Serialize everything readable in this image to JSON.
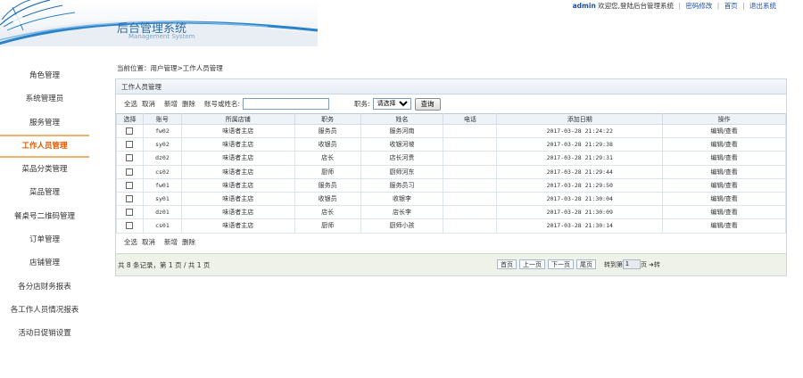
{
  "header": {
    "system_title": "后台管理系统",
    "system_subtitle": "Management System",
    "user": "admin",
    "welcome": "欢迎您,登陆后台管理系统",
    "links": [
      "密码修改",
      "首页",
      "退出系统"
    ],
    "separator": "|"
  },
  "sidebar": {
    "items": [
      {
        "label": "角色管理",
        "active": false
      },
      {
        "label": "系统管理员",
        "active": false
      },
      {
        "label": "服务管理",
        "active": false
      },
      {
        "label": "工作人员管理",
        "active": true
      },
      {
        "label": "菜品分类管理",
        "active": false
      },
      {
        "label": "菜品管理",
        "active": false
      },
      {
        "label": "餐桌号二维码管理",
        "active": false
      },
      {
        "label": "订单管理",
        "active": false
      },
      {
        "label": "店铺管理",
        "active": false
      },
      {
        "label": "各分店财务报表",
        "active": false
      },
      {
        "label": "各工作人员情况报表",
        "active": false
      },
      {
        "label": "活动日促销设置",
        "active": false
      }
    ]
  },
  "breadcrumb": "当前位置：用户管理>工作人员管理",
  "panel": {
    "title": "工作人员管理",
    "toolbar": {
      "select_all": "全选",
      "cancel": "取消",
      "add": "新增",
      "delete": "删除",
      "name_label": "账号或姓名:",
      "name_value": "",
      "role_label": "职务:",
      "role_selected": "请选择",
      "search_button": "查询"
    },
    "table": {
      "columns": [
        "选择",
        "账号",
        "所属店铺",
        "职务",
        "姓名",
        "电话",
        "添加日期",
        "操作"
      ],
      "rows": [
        {
          "account": "fw02",
          "shop": "味语者主店",
          "role": "服务员",
          "name": "服务河南",
          "phone": "",
          "date": "2017-03-28 21:24:22",
          "op": "编辑/查看"
        },
        {
          "account": "sy02",
          "shop": "味语者主店",
          "role": "收银员",
          "name": "收银河坡",
          "phone": "",
          "date": "2017-03-28 21:29:38",
          "op": "编辑/查看"
        },
        {
          "account": "dz02",
          "shop": "味语者主店",
          "role": "店长",
          "name": "店长河贵",
          "phone": "",
          "date": "2017-03-28 21:29:31",
          "op": "编辑/查看"
        },
        {
          "account": "cs02",
          "shop": "味语者主店",
          "role": "厨师",
          "name": "厨师河东",
          "phone": "",
          "date": "2017-03-28 21:29:44",
          "op": "编辑/查看"
        },
        {
          "account": "fw01",
          "shop": "味语者主店",
          "role": "服务员",
          "name": "服务员习",
          "phone": "",
          "date": "2017-03-28 21:29:50",
          "op": "编辑/查看"
        },
        {
          "account": "sy01",
          "shop": "味语者主店",
          "role": "收银员",
          "name": "收银李",
          "phone": "",
          "date": "2017-03-28 21:30:04",
          "op": "编辑/查看"
        },
        {
          "account": "dz01",
          "shop": "味语者主店",
          "role": "店长",
          "name": "店长李",
          "phone": "",
          "date": "2017-03-28 21:30:09",
          "op": "编辑/查看"
        },
        {
          "account": "cs01",
          "shop": "味语者主店",
          "role": "厨师",
          "name": "厨师小孩",
          "phone": "",
          "date": "2017-03-28 21:30:14",
          "op": "编辑/查看"
        }
      ]
    },
    "bottom_toolbar": {
      "select_all": "全选",
      "cancel": "取消",
      "add": "新增",
      "delete": "删除"
    },
    "footer": {
      "summary": "共 8 条记录，第 1 页 / 共 1 页",
      "first": "首页",
      "prev": "上一页",
      "next": "下一页",
      "last": "尾页",
      "goto_label": "转到第",
      "goto_value": "1",
      "page_unit": "页",
      "go": "➜转"
    }
  }
}
